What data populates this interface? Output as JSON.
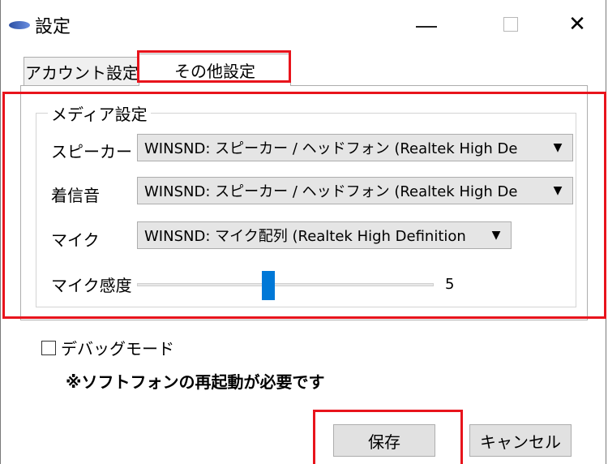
{
  "window": {
    "title": "設定",
    "minimize_icon": "minimize-icon",
    "maximize_icon": "maximize-icon",
    "close_icon": "close-icon",
    "close_glyph": "✕"
  },
  "tabs": [
    {
      "label": "アカウント設定",
      "selected": false
    },
    {
      "label": "その他設定",
      "selected": true
    }
  ],
  "media_group": {
    "title": "メディア設定",
    "speaker": {
      "label": "スピーカー",
      "value": "WINSND: スピーカー / ヘッドフォン (Realtek High De"
    },
    "ringtone": {
      "label": "着信音",
      "value": "WINSND: スピーカー / ヘッドフォン (Realtek High De"
    },
    "mic": {
      "label": "マイク",
      "value": "WINSND: マイク配列 (Realtek High Definition"
    },
    "mic_sensitivity": {
      "label": "マイク感度",
      "value": "5",
      "fraction": 0.44
    },
    "dropdown_arrow": "▼"
  },
  "debug": {
    "label": "デバッグモード",
    "checked": false
  },
  "notice": "※ソフトフォンの再起動が必要です",
  "buttons": {
    "save": "保存",
    "cancel": "キャンセル"
  },
  "colors": {
    "highlight": "#e8141c",
    "slider_thumb": "#0078d7"
  }
}
